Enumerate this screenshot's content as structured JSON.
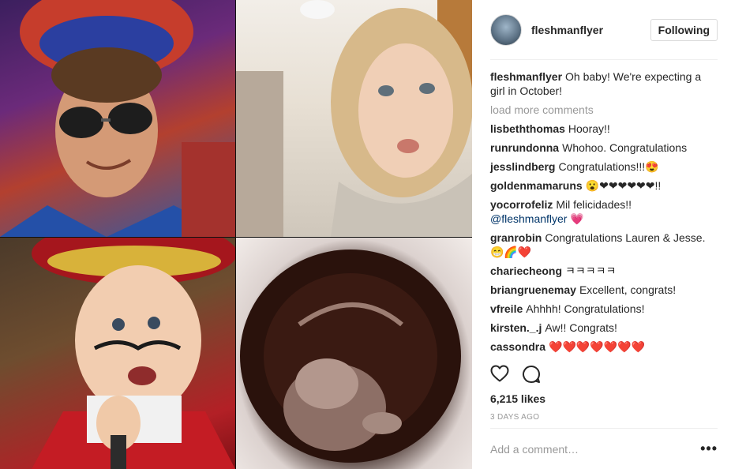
{
  "post": {
    "username": "fleshmanflyer",
    "follow_label": "Following",
    "caption_user": "fleshmanflyer",
    "caption": "Oh baby! We're expecting a girl in October!",
    "load_more": "load more comments",
    "comments": [
      {
        "user": "lisbeththomas",
        "text": "Hooray!!"
      },
      {
        "user": "runrundonna",
        "text": "Whohoo. Congratulations"
      },
      {
        "user": "jesslindberg",
        "text": "Congratulations!!!😍"
      },
      {
        "user": "goldenmamaruns",
        "text": "😮❤❤❤❤❤❤!!"
      },
      {
        "user": "yocorrofeliz",
        "text": "Mil felicidades!!",
        "mention": "@fleshmanflyer",
        "after": " 💗"
      },
      {
        "user": "granrobin",
        "text": "Congratulations Lauren & Jesse. 😁🌈❤️"
      },
      {
        "user": "chariecheong",
        "text": "ㅋㅋㅋㅋㅋ"
      },
      {
        "user": "briangruenemay",
        "text": "Excellent, congrats!"
      },
      {
        "user": "vfreile",
        "text": "Ahhhh! Congratulations!"
      },
      {
        "user": "kirsten._.j",
        "text": "Aw!! Congrats!"
      },
      {
        "user": "cassondra",
        "text": "❤️❤️❤️❤️❤️❤️❤️"
      }
    ],
    "likes": "6,215 likes",
    "time": "3 DAYS AGO",
    "add_comment_placeholder": "Add a comment…",
    "more": "•••"
  },
  "icons": {
    "like": "heart-icon",
    "comment": "speech-bubble-icon",
    "more": "more-options-icon"
  }
}
